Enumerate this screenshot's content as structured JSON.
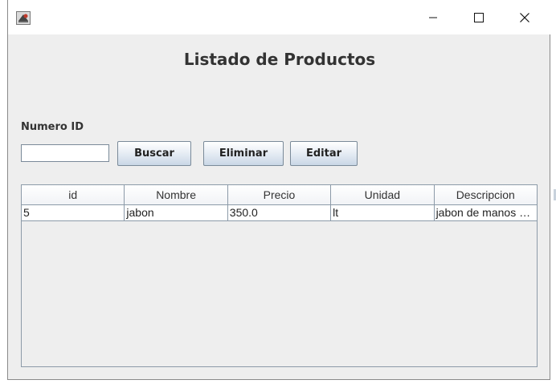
{
  "window": {
    "icon": "java-cup-icon",
    "controls": {
      "minimize": "minimize-icon",
      "maximize": "maximize-icon",
      "close": "close-icon"
    }
  },
  "heading": "Listado de Productos",
  "form": {
    "id_label": "Numero ID",
    "id_value": "",
    "buttons": {
      "search": "Buscar",
      "delete": "Eliminar",
      "edit": "Editar"
    }
  },
  "table": {
    "columns": [
      "id",
      "Nombre",
      "Precio",
      "Unidad",
      "Descripcion"
    ],
    "rows": [
      [
        "5",
        "jabon",
        "350.0",
        "lt",
        "jabon de manos y cuerpo"
      ]
    ]
  },
  "colors": {
    "window_bg": "#eeeeee",
    "titlebar_bg": "#ffffff",
    "grid": "#8c9aa8"
  }
}
